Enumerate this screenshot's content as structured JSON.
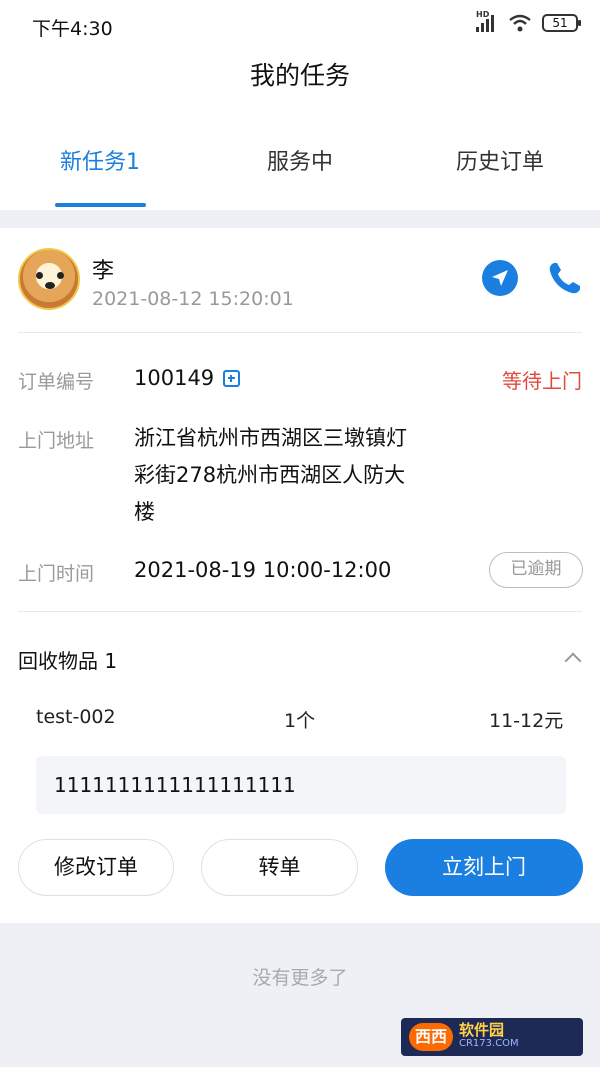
{
  "status_bar": {
    "time": "下午4:30",
    "hd": "HD",
    "battery": "51"
  },
  "header": {
    "title": "我的任务"
  },
  "tabs": [
    {
      "label": "新任务1",
      "active": true
    },
    {
      "label": "服务中",
      "active": false
    },
    {
      "label": "历史订单",
      "active": false
    }
  ],
  "order": {
    "customer_name": "李",
    "created_time": "2021-08-12 15:20:01",
    "order_no_label": "订单编号",
    "order_no": "100149",
    "status": "等待上门",
    "address_label": "上门地址",
    "address_line1": "浙江省杭州市西湖区三墩镇灯",
    "address_line2": "彩街278杭州市西湖区人防大",
    "address_line3": "楼",
    "visit_time_label": "上门时间",
    "visit_time": "2021-08-19 10:00-12:00",
    "overdue_badge": "已逾期",
    "items_title": "回收物品 1",
    "items": [
      {
        "name": "test-002",
        "qty": "1个",
        "price": "11-12元"
      }
    ],
    "note": "1111111111111111111"
  },
  "actions": {
    "modify": "修改订单",
    "transfer": "转单",
    "visit_now": "立刻上门"
  },
  "footer": {
    "no_more": "没有更多了"
  },
  "watermark": {
    "logo": "西西",
    "main": "软件园",
    "sub": "CR173.COM"
  },
  "colors": {
    "accent": "#1a7fe0",
    "status_red": "#e04a3c"
  }
}
